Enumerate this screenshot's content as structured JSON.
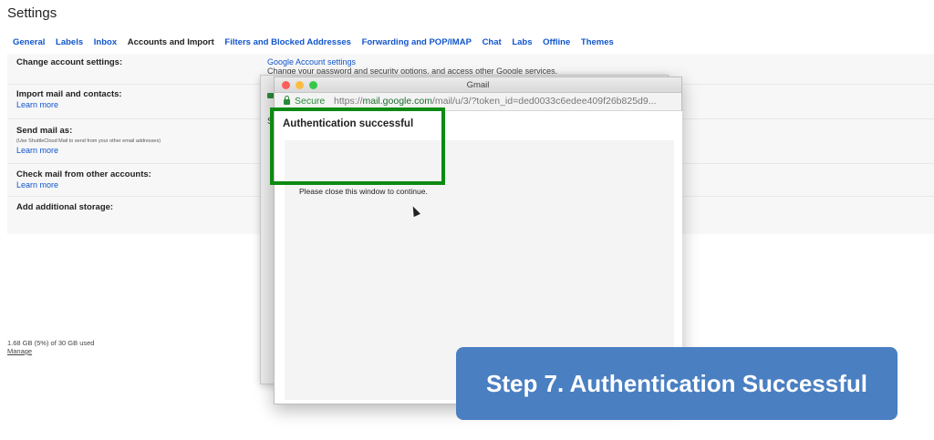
{
  "page": {
    "title": "Settings"
  },
  "tabs": [
    {
      "label": "General"
    },
    {
      "label": "Labels"
    },
    {
      "label": "Inbox"
    },
    {
      "label": "Accounts and Import"
    },
    {
      "label": "Filters and Blocked Addresses"
    },
    {
      "label": "Forwarding and POP/IMAP"
    },
    {
      "label": "Chat"
    },
    {
      "label": "Labs"
    },
    {
      "label": "Offline"
    },
    {
      "label": "Themes"
    }
  ],
  "settings": {
    "change_account": {
      "label": "Change account settings:",
      "link": "Google Account settings",
      "description": "Change your password and security options, and access other Google services."
    },
    "import_mail": {
      "label": "Import mail and contacts:",
      "link": "Learn more"
    },
    "send_mail": {
      "label": "Send mail as:",
      "note": "(Use ShuttleCloud Mail to send from your other email addresses)",
      "link": "Learn more"
    },
    "check_mail": {
      "label": "Check mail from other accounts:",
      "link": "Learn more"
    },
    "storage": {
      "label": "Add additional storage:"
    }
  },
  "storage": {
    "usage": "1.68 GB (5%) of 30 GB used",
    "manage": "Manage"
  },
  "back_window": {
    "partial_text": "S"
  },
  "popup": {
    "window_title": "Gmail",
    "secure_label": "Secure",
    "url_prefix": "https://",
    "url_domain": "mail.google.com",
    "url_path": "/mail/u/3/?token_id=ded0033c6edee409f26b825d9...",
    "auth_title": "Authentication successful",
    "auth_message": "Please close this window to continue."
  },
  "banner": {
    "text": "Step 7. Authentication Successful"
  },
  "colors": {
    "link_blue": "#1155cc",
    "highlight_green": "#0c8a13",
    "banner_blue": "#4a7fc2",
    "secure_green": "#2a8a3a"
  }
}
